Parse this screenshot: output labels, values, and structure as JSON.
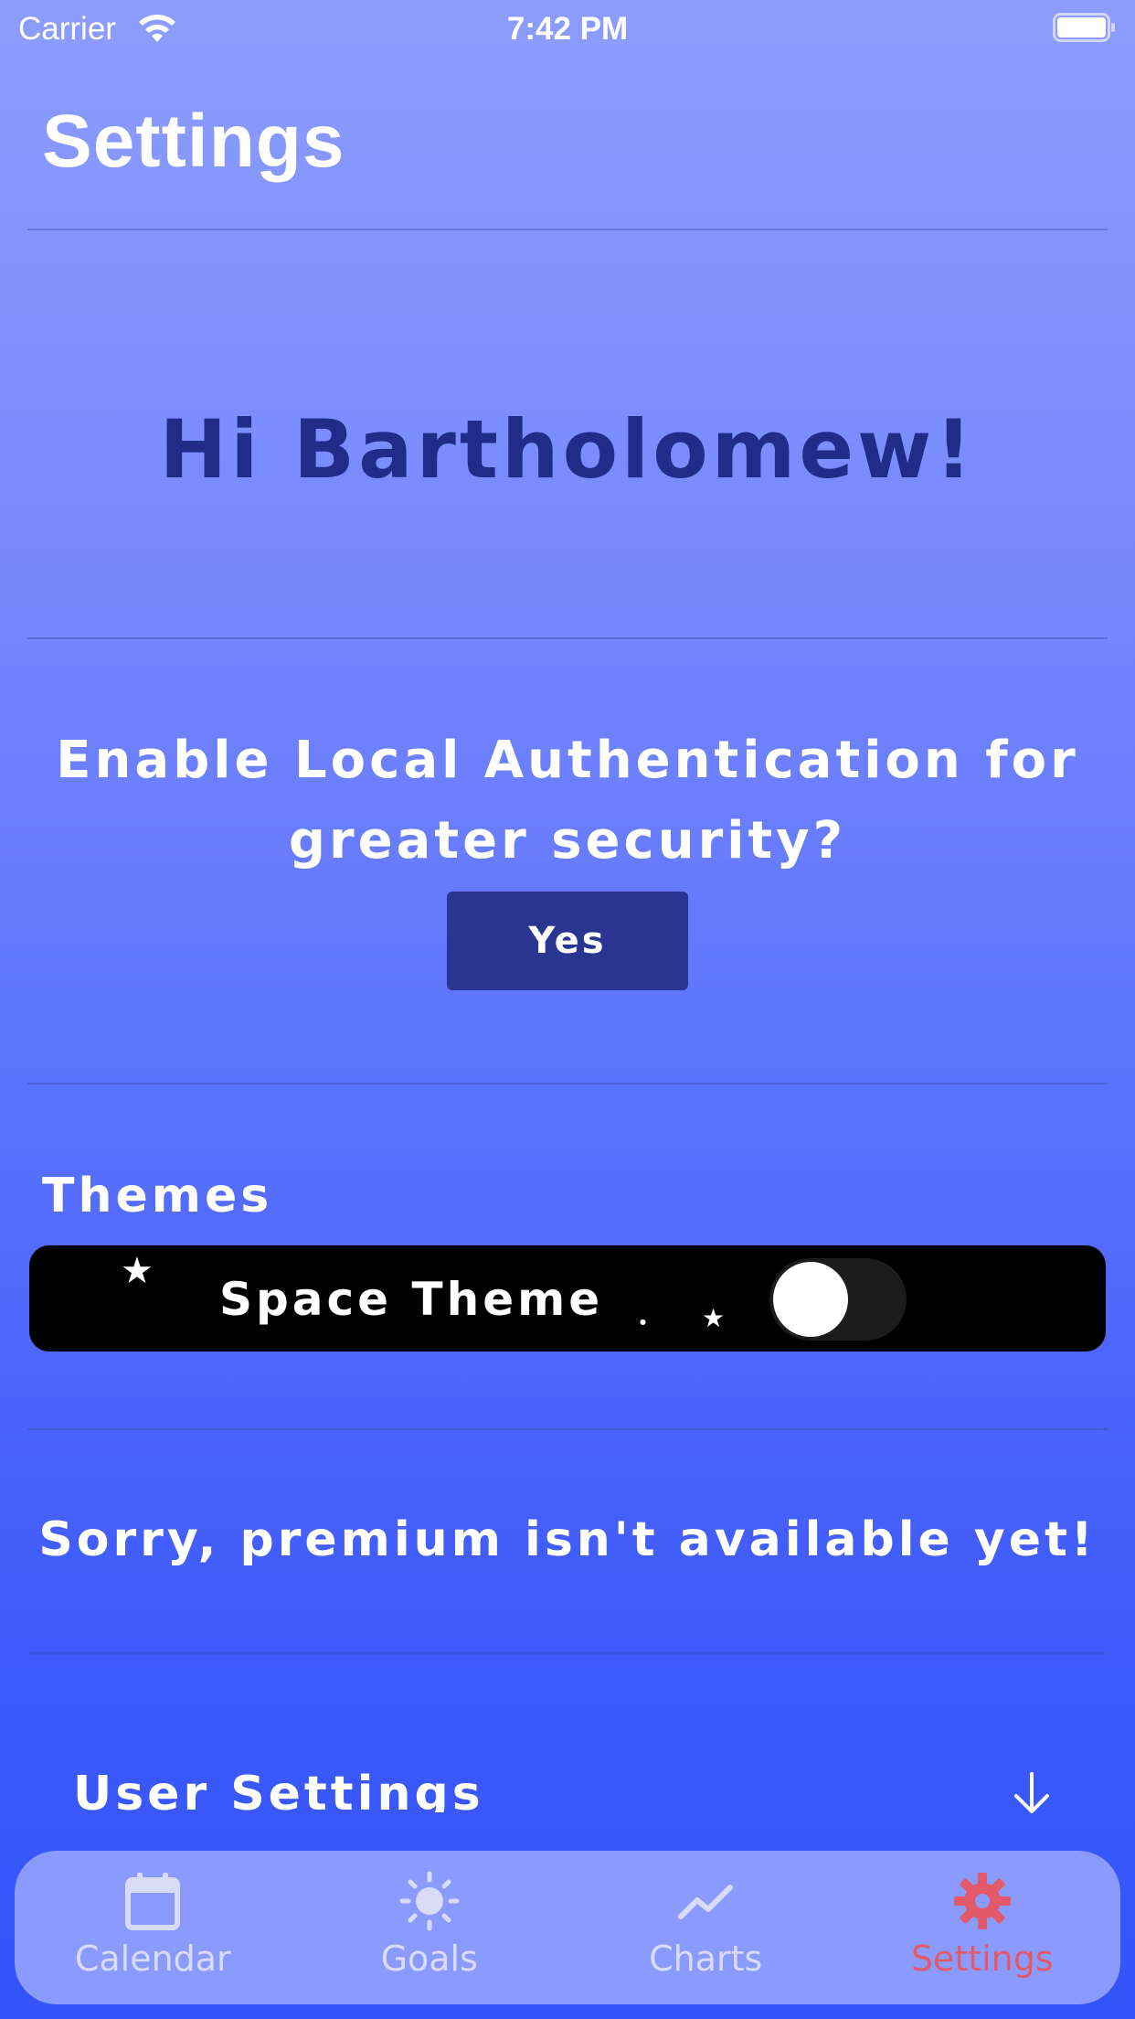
{
  "status_bar": {
    "carrier": "Carrier",
    "time": "7:42 PM"
  },
  "page": {
    "title": "Settings"
  },
  "greeting": "Hi Bartholomew!",
  "auth": {
    "prompt": "Enable Local Authentication for greater security?",
    "button_label": "Yes"
  },
  "themes": {
    "heading": "Themes",
    "space_theme_label": "Space Theme",
    "space_theme_enabled": false
  },
  "premium": {
    "message": "Sorry, premium isn't available yet!"
  },
  "user_settings": {
    "label": "User Settings"
  },
  "tab_bar": {
    "tabs": [
      {
        "label": "Calendar",
        "icon": "calendar-icon",
        "active": false
      },
      {
        "label": "Goals",
        "icon": "sun-icon",
        "active": false
      },
      {
        "label": "Charts",
        "icon": "chart-line-icon",
        "active": false
      },
      {
        "label": "Settings",
        "icon": "gear-icon",
        "active": true
      }
    ]
  },
  "colors": {
    "accent_dark": "#2a3592",
    "greeting": "#1f2d88",
    "tab_active": "#e25a6a",
    "tab_inactive": "#d8dcf6"
  }
}
